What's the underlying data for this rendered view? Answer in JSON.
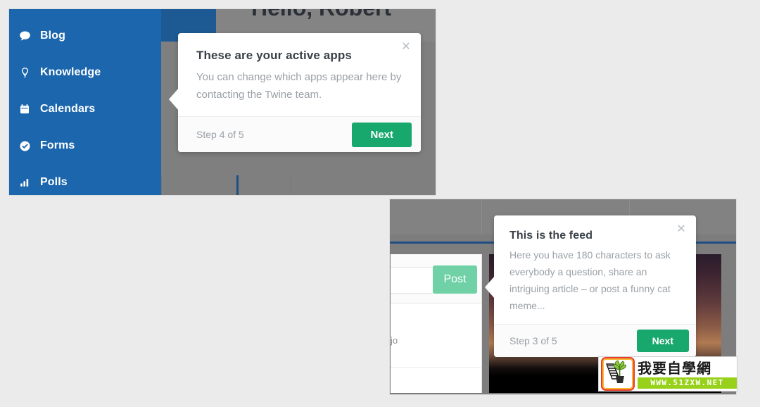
{
  "page": {
    "background_color": "#ebebeb"
  },
  "panel_one": {
    "greeting": "Hello, Robert",
    "sidebar": {
      "background_color": "#1b66ad",
      "items": [
        {
          "icon": "speech-bubble-icon",
          "label": "Blog"
        },
        {
          "icon": "lightbulb-icon",
          "label": "Knowledge"
        },
        {
          "icon": "calendar-icon",
          "label": "Calendars"
        },
        {
          "icon": "check-circle-icon",
          "label": "Forms"
        },
        {
          "icon": "bar-chart-icon",
          "label": "Polls"
        }
      ]
    },
    "tooltip": {
      "title": "These are your active apps",
      "body": "You can change which apps appear here by contacting the Twine team.",
      "step": "Step 4 of 5",
      "next_label": "Next",
      "close_icon": "close-icon",
      "accent_color": "#18a76c"
    }
  },
  "panel_two": {
    "composer": {
      "post_label": "Post",
      "post_button_color": "#6fd1a5"
    },
    "feed_card_text": "jo",
    "tooltip": {
      "title": "This is the feed",
      "body": "Here you have 180 characters to ask everybody a question, share an intriguing article – or post a funny cat meme...",
      "step": "Step 3 of 5",
      "next_label": "Next",
      "close_icon": "close-icon",
      "accent_color": "#18a76c"
    }
  },
  "watermark": {
    "site_name": "我要自學網",
    "url": "WWW.51ZXW.NET",
    "logo_icon": "plant-logo-icon",
    "url_band_color": "#98d11a"
  }
}
